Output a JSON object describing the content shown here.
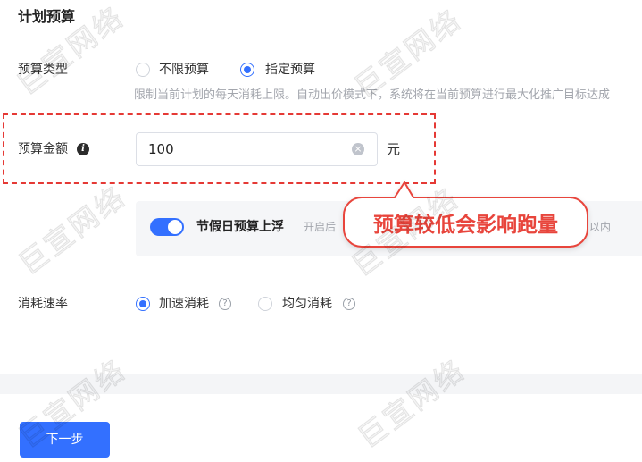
{
  "colors": {
    "accent": "#3370ff",
    "callout": "#e8453c",
    "highlight_dash": "#e53935"
  },
  "section": {
    "title": "计划预算"
  },
  "budget_type": {
    "label": "预算类型",
    "options": [
      {
        "label": "不限预算",
        "selected": false
      },
      {
        "label": "指定预算",
        "selected": true
      }
    ],
    "hint": "限制当前计划的每天消耗上限。自动出价模式下，系统将在当前预算进行最大化推广目标达成"
  },
  "budget_amount": {
    "label": "预算金额",
    "label_icon": "info-icon",
    "value": "100",
    "clear_icon": "clear-icon",
    "unit": "元"
  },
  "holiday": {
    "toggle_on": true,
    "label": "节假日预算上浮",
    "hint_start": "开启后",
    "hint_end": "以内"
  },
  "callout": {
    "text": "预算较低会影响跑量"
  },
  "spend_rate": {
    "label": "消耗速率",
    "options": [
      {
        "label": "加速消耗",
        "selected": true,
        "icon": "help-icon"
      },
      {
        "label": "均匀消耗",
        "selected": false,
        "icon": "help-icon"
      }
    ]
  },
  "next_button": {
    "label": "下一步"
  },
  "watermark": {
    "text": "巨宣网络"
  }
}
